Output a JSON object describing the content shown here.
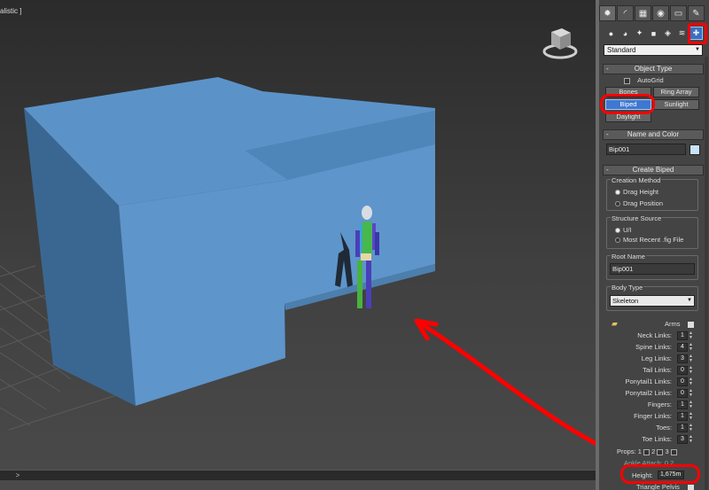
{
  "viewport": {
    "label": "alistic ]",
    "cube_label": "viewcube",
    "annotation_color": "#ff0000",
    "box_color": "#5b93c9"
  },
  "timeline": {
    "arrow": ">"
  },
  "panel": {
    "tabs": [
      "create-icon",
      "modify-icon",
      "hierarchy-icon",
      "motion-icon",
      "display-icon",
      "utilities-icon"
    ],
    "categories": [
      "geometry-icon",
      "shapes-icon",
      "lights-icon",
      "cameras-icon",
      "helpers-icon",
      "spacewarps-icon",
      "systems-icon"
    ],
    "dropdown": "Standard",
    "object_type": {
      "title": "Object Type",
      "autogrid": "AutoGrid",
      "buttons": [
        "Bones",
        "Ring Array",
        "Biped",
        "Sunlight",
        "Daylight"
      ]
    },
    "name_and_color": {
      "title": "Name and Color",
      "name": "Bip001",
      "color": "#c9e2f6"
    },
    "create_biped": {
      "title": "Create Biped",
      "creation_method": {
        "label": "Creation Method",
        "options": [
          "Drag Height",
          "Drag Position"
        ]
      },
      "structure_source": {
        "label": "Structure Source",
        "options": [
          "U/I",
          "Most Recent .fig File"
        ]
      },
      "root_name": {
        "label": "Root Name",
        "value": "Bip001"
      },
      "body_type": {
        "label": "Body Type",
        "value": "Skeleton"
      },
      "arms_label": "Arms",
      "links": [
        {
          "label": "Neck Links:",
          "value": "1"
        },
        {
          "label": "Spine Links:",
          "value": "4"
        },
        {
          "label": "Leg Links:",
          "value": "3"
        },
        {
          "label": "Tail Links:",
          "value": "0"
        },
        {
          "label": "Ponytail1 Links:",
          "value": "0"
        },
        {
          "label": "Ponytail2 Links:",
          "value": "0"
        },
        {
          "label": "Fingers:",
          "value": "1"
        },
        {
          "label": "Finger Links:",
          "value": "1"
        },
        {
          "label": "Toes:",
          "value": "1"
        },
        {
          "label": "Toe Links:",
          "value": "3"
        }
      ],
      "props": {
        "label": "Props:",
        "options": [
          "1",
          "2",
          "3"
        ]
      },
      "hidden_row": {
        "label": "Ankle Attach:",
        "value": "0,2"
      },
      "height": {
        "label": "Height:",
        "value": "1,675m"
      },
      "triangle_pelvis": "Triangle Pelvis"
    }
  }
}
